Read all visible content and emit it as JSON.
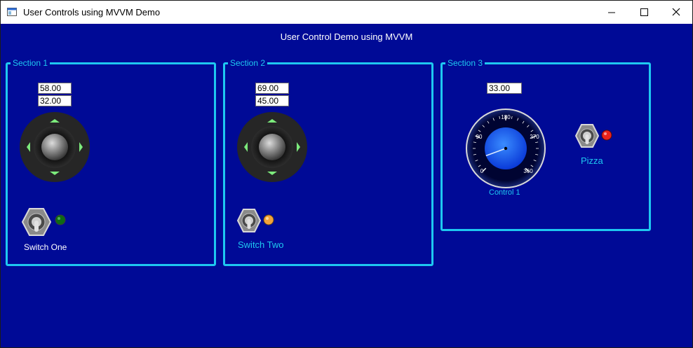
{
  "window": {
    "title": "User Controls using MVVM Demo",
    "app_icon": "window-app-icon",
    "controls": {
      "minimize": "minimize-icon",
      "maximize": "maximize-icon",
      "close": "close-icon"
    }
  },
  "header": {
    "title": "User Control Demo using MVVM"
  },
  "sections": [
    {
      "legend": "Section 1",
      "x_value": "58.00",
      "y_value": "32.00",
      "switch_label": "Switch One",
      "switch_led_color": "#0E6A14"
    },
    {
      "legend": "Section 2",
      "x_value": "69.00",
      "y_value": "45.00",
      "switch_label": "Switch Two",
      "switch_led_color": "#F2A33A"
    },
    {
      "legend": "Section 3",
      "gauge_value_text": "33.00",
      "gauge_value": 33,
      "gauge_label": "Control 1",
      "gauge_ticks": [
        "0",
        "90",
        "180",
        "270",
        "360"
      ],
      "switch_label": "Pizza",
      "switch_led_color": "#E8231C"
    }
  ],
  "colors": {
    "background": "#000A96",
    "accent": "#1EC8F0",
    "joystick_arrow": "#7CEB7C"
  }
}
